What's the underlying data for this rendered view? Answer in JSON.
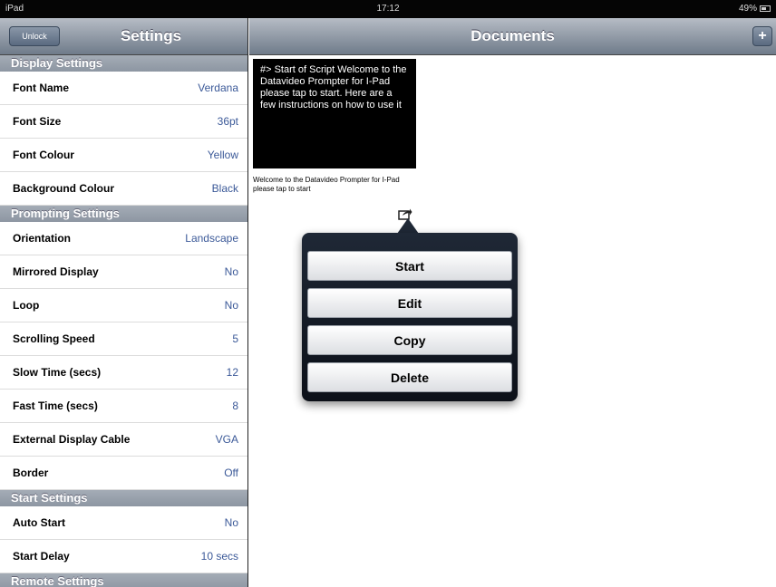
{
  "status_bar": {
    "device": "iPad",
    "time": "17:12",
    "battery_text": "49%",
    "battery_level": 0.49
  },
  "left_pane": {
    "unlock_label": "Unlock",
    "title": "Settings",
    "sections": [
      {
        "header": "Display Settings",
        "rows": [
          {
            "label": "Font Name",
            "value": "Verdana"
          },
          {
            "label": "Font Size",
            "value": "36pt"
          },
          {
            "label": "Font Colour",
            "value": "Yellow"
          },
          {
            "label": "Background Colour",
            "value": "Black"
          }
        ]
      },
      {
        "header": "Prompting Settings",
        "rows": [
          {
            "label": "Orientation",
            "value": "Landscape"
          },
          {
            "label": "Mirrored Display",
            "value": "No"
          },
          {
            "label": "Loop",
            "value": "No"
          },
          {
            "label": "Scrolling Speed",
            "value": "5"
          },
          {
            "label": "Slow Time (secs)",
            "value": "12"
          },
          {
            "label": "Fast Time (secs)",
            "value": "8"
          },
          {
            "label": "External Display Cable",
            "value": "VGA"
          },
          {
            "label": "Border",
            "value": "Off"
          }
        ]
      },
      {
        "header": "Start Settings",
        "rows": [
          {
            "label": "Auto Start",
            "value": "No"
          },
          {
            "label": "Start Delay",
            "value": "10 secs"
          }
        ]
      },
      {
        "header": "Remote Settings",
        "rows": []
      }
    ]
  },
  "right_pane": {
    "title": "Documents",
    "add_label": "+",
    "document": {
      "preview_text": "#> Start of Script Welcome to the Datavideo Prompter for I-Pad please tap to start. Here are a few instructions on how to use it",
      "caption": "Welcome to the Datavideo Prompter for I-Pad please tap to start"
    },
    "popover": {
      "start": "Start",
      "edit": "Edit",
      "copy": "Copy",
      "delete": "Delete"
    }
  },
  "colors": {
    "value_text": "#3b5998",
    "nav_bar": "#6f7b8a",
    "section_header": "#8d96a2"
  }
}
